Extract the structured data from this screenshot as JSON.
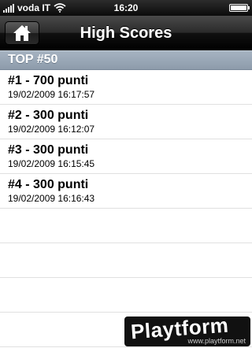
{
  "status_bar": {
    "carrier": "voda IT",
    "time": "16:20"
  },
  "nav_bar": {
    "title": "High Scores",
    "home_icon": "home-icon"
  },
  "section": {
    "header": "TOP #50"
  },
  "scores": [
    {
      "title": "#1 - 700 punti",
      "date": "19/02/2009 16:17:57"
    },
    {
      "title": "#2 - 300 punti",
      "date": "19/02/2009 16:12:07"
    },
    {
      "title": "#3 - 300 punti",
      "date": "19/02/2009 16:15:45"
    },
    {
      "title": "#4 - 300 punti",
      "date": "19/02/2009 16:16:43"
    }
  ],
  "watermark": {
    "logo": "Playtform",
    "url": "www.playtform.net"
  },
  "colors": {
    "section_header": "#97a5b5",
    "nav_bar": "#1a1a1a"
  }
}
